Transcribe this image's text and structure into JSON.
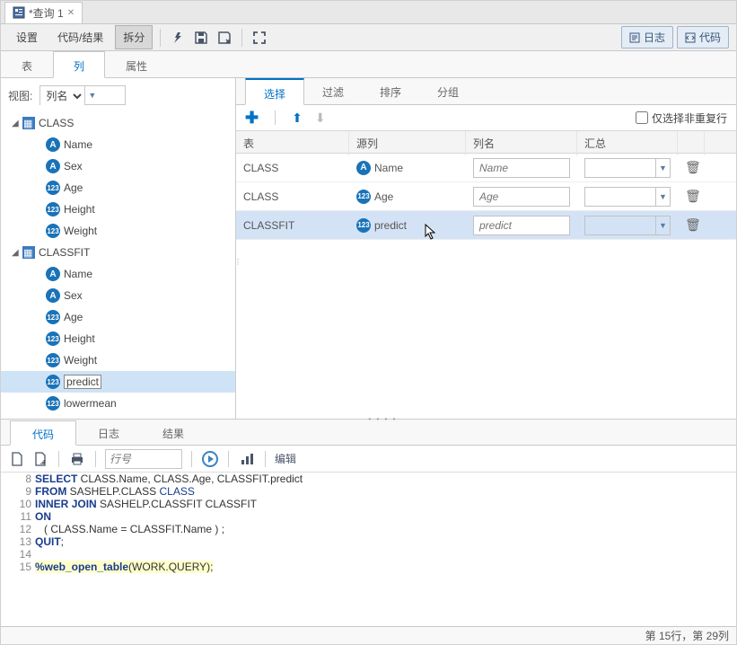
{
  "tab": {
    "title": "*查询 1"
  },
  "toolbar": {
    "settings": "设置",
    "code_result": "代码/结果",
    "split": "拆分",
    "log_btn": "日志",
    "code_btn": "代码"
  },
  "nav": {
    "table": "表",
    "column": "列",
    "attr": "属性"
  },
  "tree": {
    "view_label": "视图:",
    "view_value": "列名",
    "nodes": [
      {
        "type": "table",
        "label": "CLASS",
        "children": [
          {
            "dtype": "A",
            "label": "Name"
          },
          {
            "dtype": "A",
            "label": "Sex"
          },
          {
            "dtype": "N",
            "label": "Age"
          },
          {
            "dtype": "N",
            "label": "Height"
          },
          {
            "dtype": "N",
            "label": "Weight"
          }
        ]
      },
      {
        "type": "table",
        "label": "CLASSFIT",
        "children": [
          {
            "dtype": "A",
            "label": "Name"
          },
          {
            "dtype": "A",
            "label": "Sex"
          },
          {
            "dtype": "N",
            "label": "Age"
          },
          {
            "dtype": "N",
            "label": "Height"
          },
          {
            "dtype": "N",
            "label": "Weight"
          },
          {
            "dtype": "N",
            "label": "predict",
            "selected": true
          },
          {
            "dtype": "N",
            "label": "lowermean"
          }
        ]
      }
    ]
  },
  "sel": {
    "tabs": {
      "select": "选择",
      "filter": "过滤",
      "sort": "排序",
      "group": "分组"
    },
    "distinct_label": "仅选择非重复行",
    "headers": {
      "table": "表",
      "srccol": "源列",
      "colname": "列名",
      "agg": "汇总"
    },
    "rows": [
      {
        "table": "CLASS",
        "dtype": "A",
        "src": "Name",
        "name_ph": "Name"
      },
      {
        "table": "CLASS",
        "dtype": "N",
        "src": "Age",
        "name_ph": "Age"
      },
      {
        "table": "CLASSFIT",
        "dtype": "N",
        "src": "predict",
        "name_ph": "predict",
        "selected": true
      }
    ]
  },
  "bottom": {
    "tabs": {
      "code": "代码",
      "log": "日志",
      "result": "结果"
    },
    "lineno_ph": "行号",
    "edit_label": "编辑"
  },
  "code": {
    "lines": [
      {
        "n": 8,
        "kw": "SELECT",
        "rest": " CLASS.Name, CLASS.Age, CLASSFIT.predict"
      },
      {
        "n": 9,
        "kw": "FROM",
        "rest": " SASHELP.CLASS ",
        "al": "CLASS"
      },
      {
        "n": 10,
        "kw": "INNER",
        "kw2": "JOIN",
        "rest": " SASHELP.CLASSFIT CLASSFIT"
      },
      {
        "n": 11,
        "kw": "ON",
        "rest": ""
      },
      {
        "n": 12,
        "rest": "   ( CLASS.Name = CLASSFIT.Name ) ;"
      },
      {
        "n": 13,
        "kw": "QUIT",
        "rest": ";"
      },
      {
        "n": 14,
        "rest": ""
      },
      {
        "n": 15,
        "macro": "%web_open_table",
        "rest": "(WORK.QUERY);",
        "hl": true
      }
    ]
  },
  "status": "第 15行，第 29列"
}
